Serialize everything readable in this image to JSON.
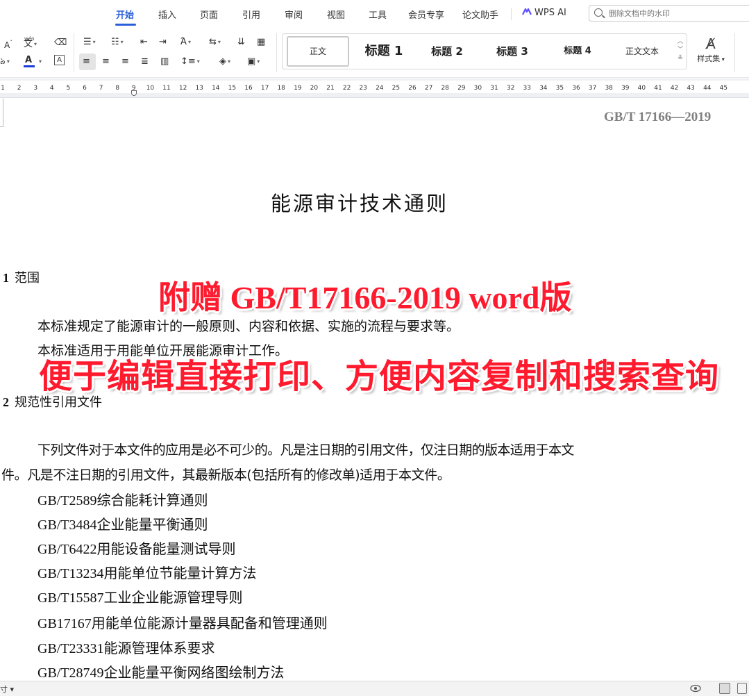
{
  "tabs": [
    {
      "label": "开始",
      "active": true
    },
    {
      "label": "插入"
    },
    {
      "label": "页面"
    },
    {
      "label": "引用"
    },
    {
      "label": "审阅"
    },
    {
      "label": "视图"
    },
    {
      "label": "工具"
    },
    {
      "label": "会员专享"
    },
    {
      "label": "论文助手"
    }
  ],
  "wps_ai": "WPS AI",
  "search": {
    "placeholder": "删除文档中的水印"
  },
  "toolbar": {
    "font_shrink": "A⁻",
    "phonetic": "文",
    "phonetic_top": "wén",
    "clear_format": "◇",
    "font_color": "A",
    "char_border": "A"
  },
  "styles": [
    {
      "label": "正文"
    },
    {
      "label": "标题 1"
    },
    {
      "label": "标题 2"
    },
    {
      "label": "标题 3"
    },
    {
      "label": "标题 4"
    },
    {
      "label": "正文文本"
    }
  ],
  "style_set_label": "样式集",
  "ruler": {
    "ticks": [
      "1",
      "2",
      "3",
      "4",
      "5",
      "6",
      "7",
      "8",
      "9",
      "10",
      "11",
      "12",
      "13",
      "14",
      "15",
      "16",
      "17",
      "18",
      "19",
      "20",
      "21",
      "22",
      "23",
      "24",
      "25",
      "26",
      "27",
      "28",
      "29",
      "30",
      "31",
      "32",
      "33",
      "34",
      "35",
      "36",
      "37",
      "38",
      "39",
      "40",
      "41",
      "42",
      "43",
      "44",
      "45"
    ]
  },
  "document": {
    "header_code": "GB/T 17166—2019",
    "title": "能源审计技术通则",
    "section1": {
      "num": "1",
      "title": "范围"
    },
    "section1_p1": "本标准规定了能源审计的一般原则、内容和依据、实施的流程与要求等。",
    "section1_p2": "本标准适用于用能单位开展能源审计工作。",
    "section2": {
      "num": "2",
      "title": "规范性引用文件"
    },
    "section2_p1_line1": "下列文件对于本文件的应用是必不可少的。凡是注日期的引用文件，仅注日期的版本适用于本文",
    "section2_p1_line2": "件。凡是不注日期的引用文件，其最新版本(包括所有的修改单)适用于本文件。",
    "references": [
      "GB/T2589综合能耗计算通则",
      "GB/T3484企业能量平衡通则",
      "GB/T6422用能设备能量测试导则",
      "GB/T13234用能单位节能量计算方法",
      "GB/T15587工业企业能源管理导则",
      "GB17167用能单位能源计量器具配备和管理通则",
      "GB/T23331能源管理体系要求",
      "GB/T28749企业能量平衡网络图绘制方法"
    ]
  },
  "promo": {
    "line1": "附赠 GB/T17166-2019 word版",
    "line2": "便于编辑直接打印、方便内容复制和搜索查询"
  },
  "status": {
    "left": "寸 ▾"
  },
  "colors": {
    "accent": "#2b5fd9",
    "promo": "#ff1a2e",
    "header_gray": "#808080"
  }
}
